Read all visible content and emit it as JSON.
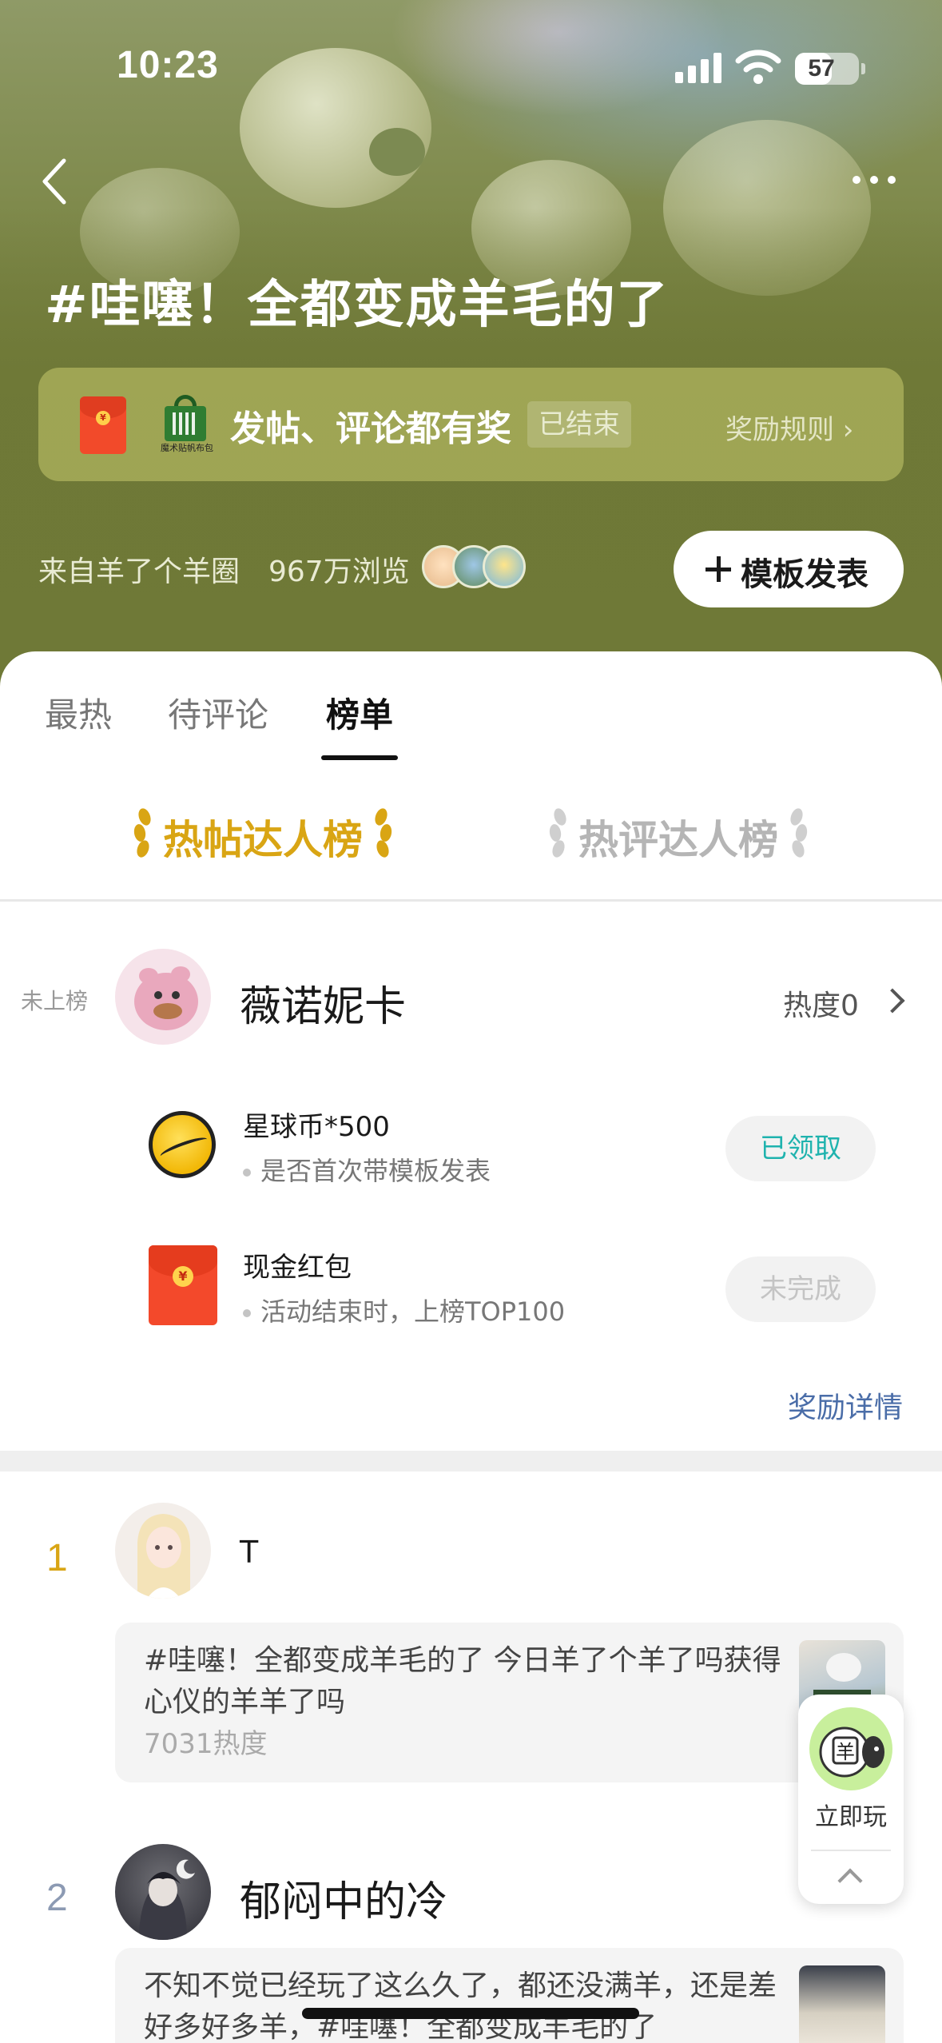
{
  "status_bar": {
    "time": "10:23",
    "battery_level": 57,
    "battery_label": "57"
  },
  "header": {
    "topic_title": "#哇噻！全都变成羊毛的了",
    "reward_text": "发帖、评论都有奖",
    "reward_status": "已结束",
    "rules_link": "奖励规则 ›",
    "bag_caption": "魔术贴帆布包",
    "source_views": "来自羊了个羊圈　967万浏览",
    "template_button": "模板发表"
  },
  "tabs": [
    {
      "label": "最热",
      "active": false
    },
    {
      "label": "待评论",
      "active": false
    },
    {
      "label": "榜单",
      "active": true
    }
  ],
  "rank_switch": {
    "hot_post": "热帖达人榜",
    "hot_comment": "热评达人榜",
    "active": "hot_post",
    "active_color": "#d9a514",
    "inactive_color": "#b5b5b5"
  },
  "my_rank": {
    "status": "未上榜",
    "name": "薇诺妮卡",
    "heat": "热度0"
  },
  "tasks": [
    {
      "icon": "coin-icon",
      "name": "星球币*500",
      "desc": "是否首次带模板发表",
      "button": "已领取",
      "button_color": "#1fb3ae"
    },
    {
      "icon": "red-envelope-icon",
      "name": "现金红包",
      "desc": "活动结束时，上榜TOP100",
      "button": "未完成",
      "button_color": "#c4c4c4"
    }
  ],
  "reward_detail_link": "奖励详情",
  "leaderboard": [
    {
      "rank": "1",
      "rank_color": "#d9a514",
      "name": "T",
      "post_text": "#哇噻！全都变成羊毛的了 今日羊了个羊了吗获得心仪的羊羊了吗",
      "heat": "7031热度"
    },
    {
      "rank": "2",
      "rank_color": "#8c9ab3",
      "name": "郁闷中的冷",
      "post_text": "不知不觉已经玩了这么久了，都还没满羊，还是差好多好多羊，#哇噻！全都变成羊毛的了"
    }
  ],
  "float_widget": {
    "label": "立即玩",
    "logo_char": "羊"
  },
  "colors": {
    "accent_blue": "#4a6da8",
    "hero_olive": "#737d3c"
  }
}
